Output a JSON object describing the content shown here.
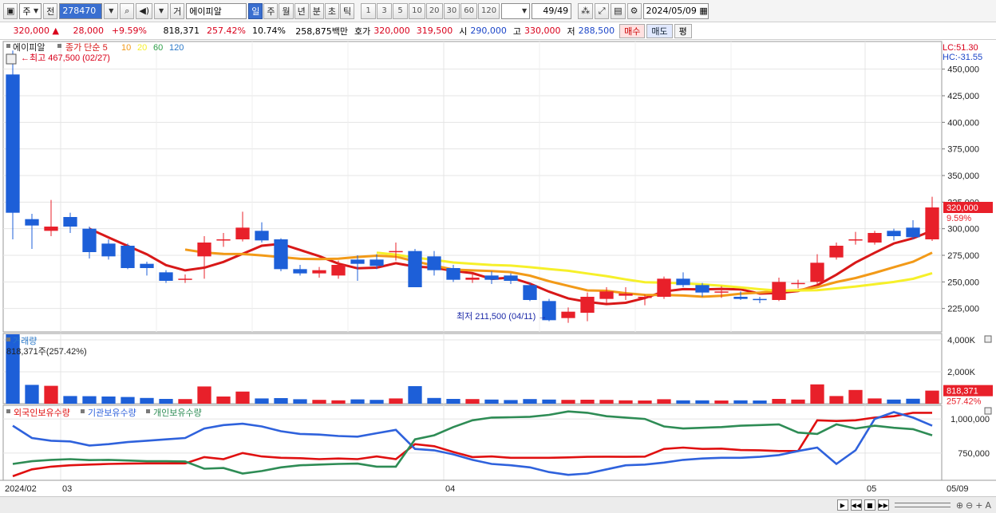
{
  "toolbar": {
    "market": "주",
    "prev": "전",
    "code": "278470",
    "search_icon": "magnifier-icon",
    "sound_icon": "speaker-icon",
    "cmd": "거",
    "name": "에이피알",
    "periods": [
      "일",
      "주",
      "월",
      "년",
      "분",
      "초",
      "틱"
    ],
    "active_period": "일",
    "units": [
      "1",
      "3",
      "5",
      "10",
      "20",
      "30",
      "60",
      "120"
    ],
    "count": "49/49",
    "date": "2024/05/09"
  },
  "quote": {
    "price": "320,000",
    "change": "28,000",
    "change_pct": "+9.59%",
    "volume": "818,371",
    "vol_ratio": "257.42%",
    "turnover": "10.74%",
    "amount": "258,875백만",
    "ask_label": "호가",
    "ask1": "320,000",
    "ask2": "319,500",
    "open_label": "시",
    "open": "290,000",
    "high_label": "고",
    "high": "330,000",
    "low_label": "저",
    "low": "288,500",
    "buy": "매수",
    "sell": "매도",
    "flat": "평"
  },
  "chart_data": {
    "type": "candlestick",
    "stock_label": "에이피알",
    "legend_prefix": "종가 단순",
    "ma_periods": [
      "5",
      "10",
      "20",
      "60",
      "120"
    ],
    "ma_colors": [
      "#d81818",
      "#f29a18",
      "#f6f02a",
      "#2fa04a",
      "#2a78c8"
    ],
    "lc": "LC:51.30",
    "hc": "HC:-31.55",
    "high_marker": "최고 467,500 (02/27)",
    "low_marker": "최저 211,500 (04/11)",
    "price_ticks": [
      "450,000",
      "425,000",
      "400,000",
      "375,000",
      "350,000",
      "325,000",
      "300,000",
      "275,000",
      "250,000",
      "225,000"
    ],
    "price_ylim": [
      203000,
      476000
    ],
    "current_price": "320,000",
    "current_pct": "9.59%",
    "x_labels": [
      "2024/02",
      "03",
      "04",
      "05",
      "05/09"
    ],
    "candles": [
      [
        445000,
        315000,
        467500,
        290000
      ],
      [
        309000,
        303000,
        314000,
        281000
      ],
      [
        298000,
        302000,
        327000,
        293000
      ],
      [
        311000,
        302000,
        315000,
        296000
      ],
      [
        300000,
        278000,
        302000,
        272000
      ],
      [
        286000,
        274000,
        290000,
        271000
      ],
      [
        284000,
        263000,
        286000,
        262000
      ],
      [
        267000,
        263000,
        269000,
        256000
      ],
      [
        259000,
        251000,
        261000,
        249000
      ],
      [
        253000,
        253000,
        257000,
        249000
      ],
      [
        274000,
        287000,
        293000,
        253000
      ],
      [
        289000,
        290000,
        296000,
        283000
      ],
      [
        290000,
        301000,
        316000,
        288000
      ],
      [
        298000,
        289000,
        306000,
        287000
      ],
      [
        290000,
        262000,
        291000,
        260000
      ],
      [
        262000,
        258000,
        266000,
        256000
      ],
      [
        258000,
        261000,
        264000,
        254000
      ],
      [
        256000,
        266000,
        270000,
        253000
      ],
      [
        271000,
        267000,
        275000,
        251000
      ],
      [
        271000,
        265000,
        276000,
        262000
      ],
      [
        279000,
        279000,
        287000,
        270000
      ],
      [
        279000,
        245000,
        281000,
        245000
      ],
      [
        274000,
        261000,
        279000,
        256000
      ],
      [
        263000,
        252000,
        266000,
        250000
      ],
      [
        252000,
        254000,
        258000,
        249000
      ],
      [
        256000,
        252000,
        260000,
        248000
      ],
      [
        256000,
        251000,
        258000,
        248000
      ],
      [
        247000,
        233000,
        249000,
        232000
      ],
      [
        232000,
        214000,
        234000,
        213000
      ],
      [
        216000,
        222000,
        226000,
        211500
      ],
      [
        221000,
        236000,
        240000,
        213000
      ],
      [
        234000,
        241000,
        245000,
        230000
      ],
      [
        237000,
        239000,
        245000,
        233000
      ],
      [
        235000,
        236000,
        238000,
        228000
      ],
      [
        236000,
        253000,
        255000,
        234000
      ],
      [
        253000,
        247000,
        259000,
        245000
      ],
      [
        247000,
        240000,
        249000,
        236000
      ],
      [
        240000,
        241000,
        246000,
        235000
      ],
      [
        236000,
        234000,
        241000,
        233000
      ],
      [
        234000,
        233000,
        236000,
        230000
      ],
      [
        233000,
        250000,
        254000,
        232000
      ],
      [
        248000,
        249000,
        252000,
        244000
      ],
      [
        250000,
        268000,
        276000,
        248000
      ],
      [
        273000,
        284000,
        287000,
        271000
      ],
      [
        289000,
        290000,
        297000,
        285000
      ],
      [
        287000,
        296000,
        298000,
        285000
      ],
      [
        298000,
        293000,
        300000,
        289000
      ],
      [
        301000,
        292000,
        308000,
        290000
      ],
      [
        290000,
        320000,
        330000,
        288500
      ]
    ],
    "volume_label": "거래량",
    "volume_info": "818,371주(257.42%)",
    "volume_ticks": [
      "4,000K",
      "2,000K"
    ],
    "volume_ylim": [
      0,
      4400000
    ],
    "volume_current": "818,371",
    "volume_current_pct": "257.42%",
    "volumes": [
      4350000,
      1180000,
      1120000,
      480000,
      470000,
      450000,
      420000,
      360000,
      300000,
      290000,
      1080000,
      450000,
      760000,
      330000,
      350000,
      280000,
      240000,
      210000,
      270000,
      240000,
      330000,
      1100000,
      360000,
      300000,
      290000,
      260000,
      230000,
      290000,
      260000,
      240000,
      250000,
      240000,
      210000,
      200000,
      280000,
      210000,
      210000,
      200000,
      210000,
      200000,
      300000,
      260000,
      1210000,
      480000,
      860000,
      330000,
      260000,
      310000,
      820000
    ],
    "holdings_labels": [
      "외국인보유수량",
      "기관보유수량",
      "개인보유수량"
    ],
    "holdings_colors": [
      "#e01010",
      "#2f62dc",
      "#2e8c55"
    ],
    "holdings_ticks": [
      "1,000,000",
      "750,000"
    ],
    "holdings_ylim": [
      550000,
      1100000
    ],
    "foreign": [
      580000,
      630000,
      650000,
      660000,
      665000,
      670000,
      672000,
      674000,
      674000,
      674000,
      720000,
      705000,
      750000,
      725000,
      715000,
      712000,
      705000,
      710000,
      705000,
      725000,
      705000,
      815000,
      800000,
      758000,
      720000,
      725000,
      715000,
      715000,
      715000,
      718000,
      722000,
      723000,
      722000,
      724000,
      780000,
      790000,
      780000,
      782000,
      772000,
      770000,
      765000,
      765000,
      990000,
      985000,
      990000,
      1010000,
      1020000,
      1045000,
      1045000
    ],
    "institution": [
      950000,
      860000,
      840000,
      835000,
      805000,
      815000,
      830000,
      840000,
      850000,
      860000,
      930000,
      955000,
      965000,
      945000,
      910000,
      890000,
      885000,
      875000,
      870000,
      895000,
      920000,
      780000,
      770000,
      740000,
      700000,
      670000,
      660000,
      645000,
      610000,
      590000,
      600000,
      630000,
      660000,
      665000,
      680000,
      700000,
      710000,
      715000,
      715000,
      722000,
      735000,
      765000,
      790000,
      670000,
      770000,
      1000000,
      1050000,
      1010000,
      950000
    ],
    "individual": [
      670000,
      690000,
      700000,
      705000,
      698000,
      700000,
      695000,
      690000,
      690000,
      688000,
      635000,
      640000,
      600000,
      618000,
      645000,
      660000,
      665000,
      670000,
      672000,
      650000,
      650000,
      850000,
      880000,
      940000,
      990000,
      1010000,
      1012000,
      1016000,
      1030000,
      1055000,
      1045000,
      1020000,
      1010000,
      1000000,
      945000,
      930000,
      935000,
      940000,
      950000,
      955000,
      960000,
      900000,
      890000,
      960000,
      930000,
      950000,
      935000,
      925000,
      880000
    ],
    "holdings_current": "1,000,000"
  }
}
